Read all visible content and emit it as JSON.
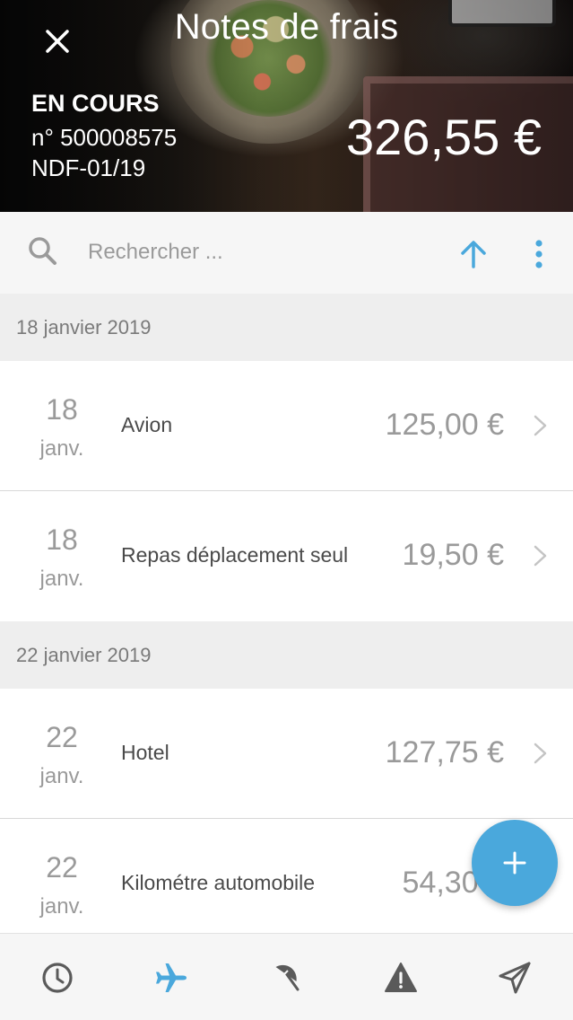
{
  "header": {
    "title": "Notes de frais",
    "status": "EN COURS",
    "report_number": "n° 500008575",
    "report_ref": "NDF-01/19",
    "total": "326,55 €"
  },
  "search": {
    "placeholder": "Rechercher ..."
  },
  "groups": [
    {
      "date": "18 janvier 2019",
      "items": [
        {
          "day": "18",
          "month": "janv.",
          "label": "Avion",
          "amount": "125,00 €"
        },
        {
          "day": "18",
          "month": "janv.",
          "label": "Repas déplacement seul",
          "amount": "19,50 €"
        }
      ]
    },
    {
      "date": "22 janvier 2019",
      "items": [
        {
          "day": "22",
          "month": "janv.",
          "label": "Hotel",
          "amount": "127,75 €"
        },
        {
          "day": "22",
          "month": "janv.",
          "label": "Kilométre automobile",
          "amount": "54,30 €"
        }
      ]
    }
  ],
  "bottom_nav": [
    {
      "icon": "clock-icon",
      "active": false
    },
    {
      "icon": "airplane-icon",
      "active": true
    },
    {
      "icon": "umbrella-icon",
      "active": false
    },
    {
      "icon": "warning-icon",
      "active": false
    },
    {
      "icon": "send-icon",
      "active": false
    }
  ],
  "colors": {
    "accent": "#4aa8dc",
    "icon_gray": "#5a5a5a",
    "text_gray": "#9a9a9a"
  }
}
